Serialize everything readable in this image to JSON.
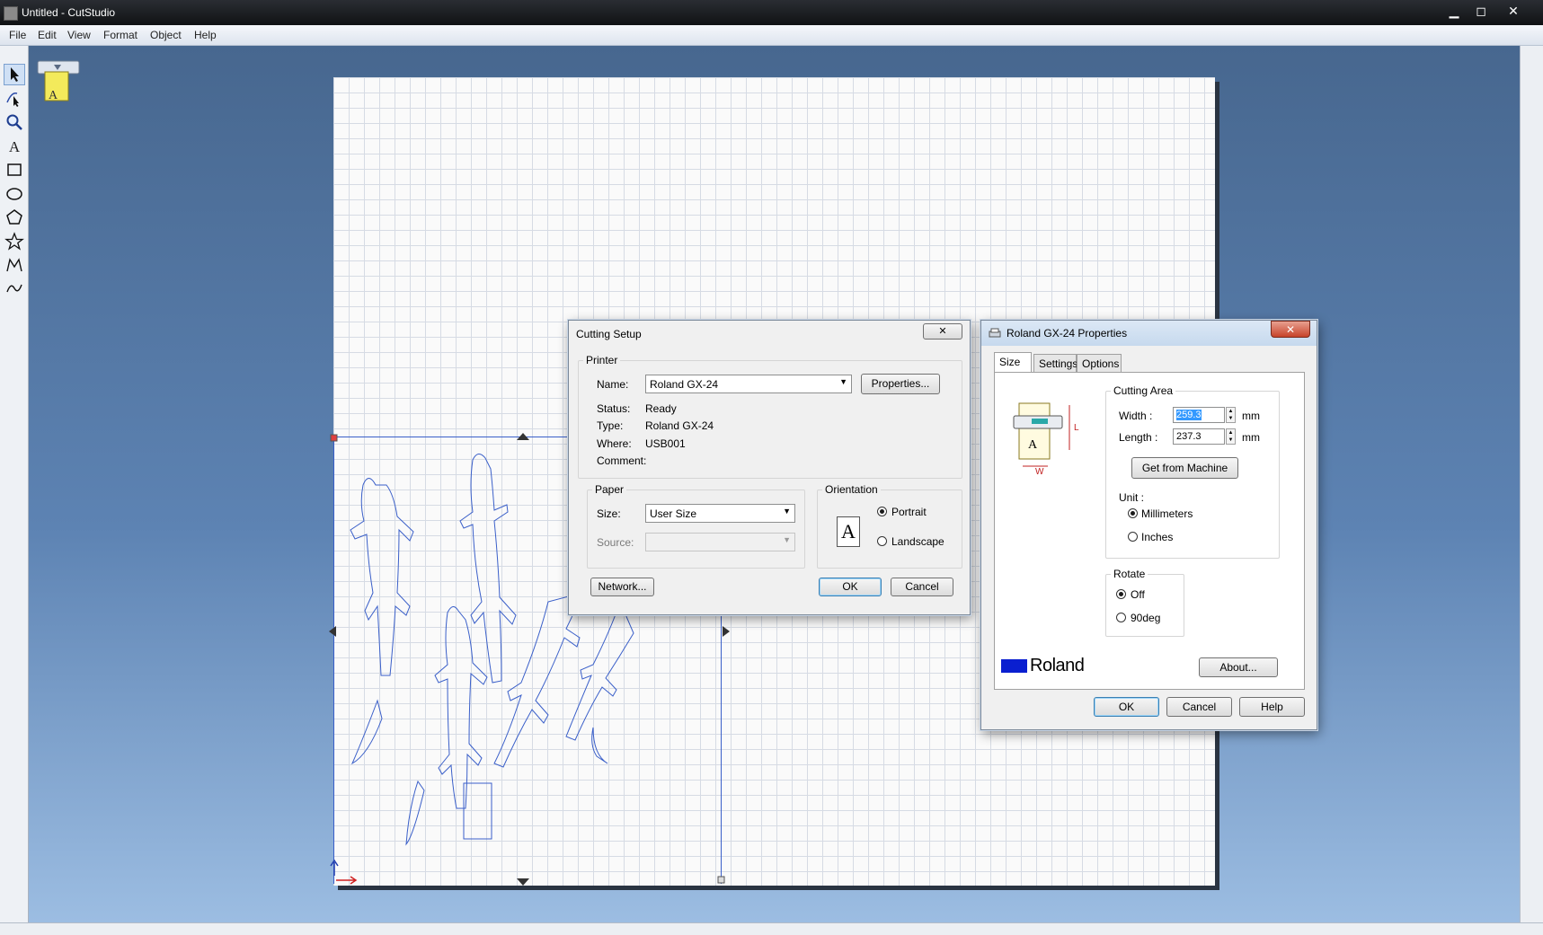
{
  "window": {
    "title": "Untitled - CutStudio",
    "minimize": "▁",
    "maximize": "◻",
    "close": "✕"
  },
  "menu": [
    "File",
    "Edit",
    "View",
    "Format",
    "Object",
    "Help"
  ],
  "tools": [
    "select-arrow",
    "node-edit",
    "zoom",
    "text",
    "rectangle",
    "ellipse",
    "polygon",
    "star",
    "polyline",
    "curve"
  ],
  "cutting_setup": {
    "title": "Cutting Setup",
    "close": "✕",
    "printer_group": "Printer",
    "name_label": "Name:",
    "name_value": "Roland GX-24",
    "properties_button": "Properties...",
    "status_label": "Status:",
    "status_value": "Ready",
    "type_label": "Type:",
    "type_value": "Roland GX-24",
    "where_label": "Where:",
    "where_value": "USB001",
    "comment_label": "Comment:",
    "paper_group": "Paper",
    "size_label": "Size:",
    "size_value": "User Size",
    "source_label": "Source:",
    "orientation_group": "Orientation",
    "orientation_glyph": "A",
    "portrait": "Portrait",
    "landscape": "Landscape",
    "network_button": "Network...",
    "ok_button": "OK",
    "cancel_button": "Cancel"
  },
  "properties": {
    "title": "Roland GX-24 Properties",
    "close": "✕",
    "tabs": [
      "Size",
      "Settings",
      "Options"
    ],
    "cutting_area_group": "Cutting Area",
    "width_label": "Width :",
    "width_value": "259.3",
    "length_label": "Length :",
    "length_value": "237.3",
    "unit_mm": "mm",
    "get_from_machine_button": "Get from Machine",
    "unit_label": "Unit :",
    "millimeters": "Millimeters",
    "inches": "Inches",
    "rotate_group": "Rotate",
    "rotate_off": "Off",
    "rotate_90": "90deg",
    "about_button": "About...",
    "brand": "Roland",
    "diagram_L": "L",
    "diagram_W": "W",
    "diagram_A": "A",
    "ok_button": "OK",
    "cancel_button": "Cancel",
    "help_button": "Help"
  },
  "colors": {
    "selection": "#3a5fc9",
    "brand_blue": "#0a1fd0"
  }
}
